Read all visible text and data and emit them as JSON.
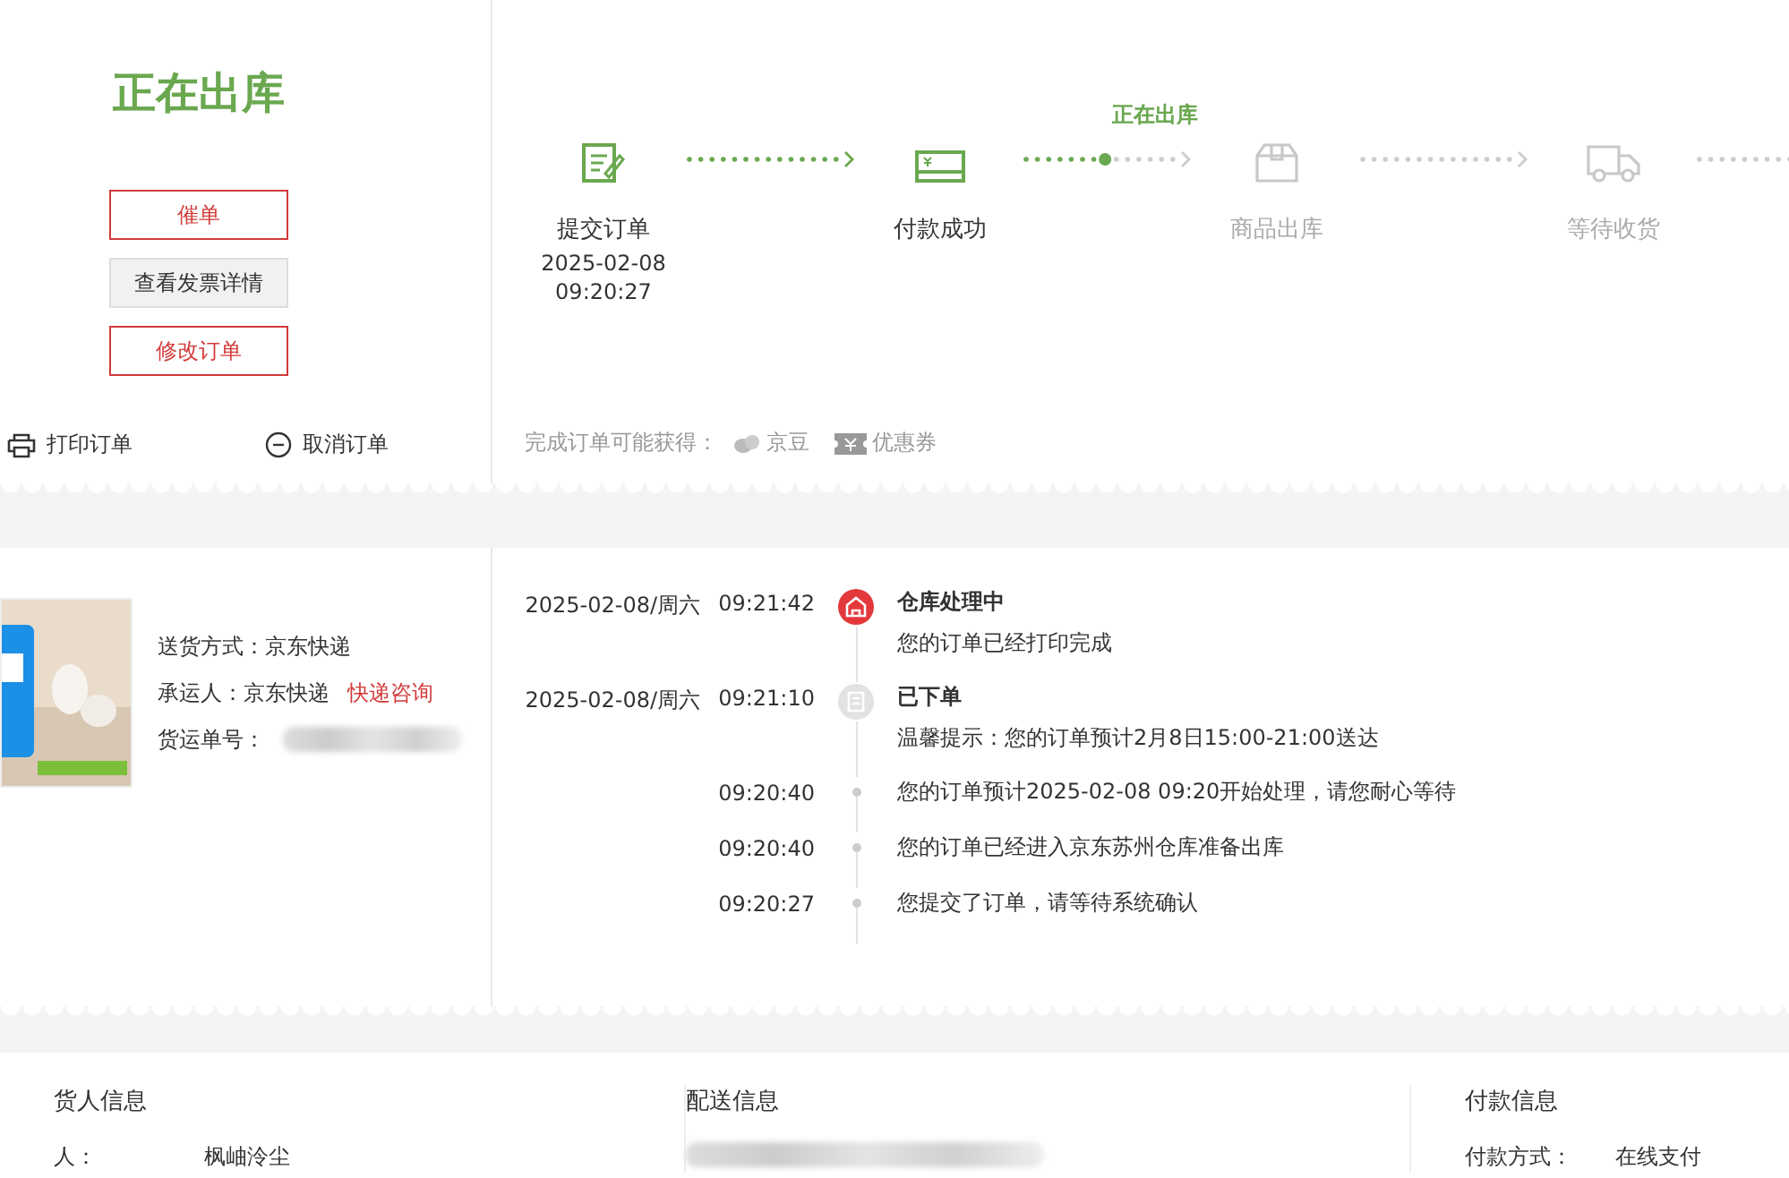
{
  "status": {
    "title": "正在出库"
  },
  "actions": [
    {
      "label": "催单",
      "kind": "primary"
    },
    {
      "label": "查看发票详情",
      "kind": "secondary"
    },
    {
      "label": "修改订单",
      "kind": "primary"
    }
  ],
  "links": [
    {
      "label": "打印订单",
      "kind": "printer"
    },
    {
      "label": "取消订单",
      "kind": "cancel"
    }
  ],
  "steps": [
    {
      "label": "提交订单",
      "date": "2025-02-08",
      "time": "09:20:27",
      "done": true,
      "kind": "form"
    },
    {
      "label": "付款成功",
      "done": true,
      "kind": "card"
    },
    {
      "label": "商品出库",
      "done": false,
      "kind": "box"
    },
    {
      "label": "等待收货",
      "done": false,
      "kind": "truck"
    }
  ],
  "connectors": [
    {
      "kind": "done"
    },
    {
      "kind": "active",
      "label": "正在出库"
    },
    {
      "kind": "pending"
    },
    {
      "kind": "pending"
    }
  ],
  "rewards": {
    "label": "完成订单可能获得：",
    "items": [
      {
        "label": "京豆",
        "kind": "bean"
      },
      {
        "label": "优惠券",
        "kind": "coupon"
      }
    ]
  },
  "shipment": {
    "fields": [
      {
        "label": "送货方式：",
        "value": "京东快递"
      },
      {
        "label": "承运人：",
        "value": "京东快递",
        "link": "快递咨询"
      },
      {
        "label": "货运单号：",
        "redacted": true
      }
    ]
  },
  "tracking": [
    {
      "kind": "current",
      "date": "2025-02-08/周六",
      "time": "09:21:42",
      "title": "仓库处理中",
      "text": "您的订单已经打印完成"
    },
    {
      "kind": "major",
      "date": "2025-02-08/周六",
      "time": "09:21:10",
      "title": "已下单",
      "text": "温馨提示：您的订单预计2月8日15:00-21:00送达"
    },
    {
      "kind": "minor",
      "time": "09:20:40",
      "text": "您的订单预计2025-02-08 09:20开始处理，请您耐心等待"
    },
    {
      "kind": "minor",
      "time": "09:20:40",
      "text": "您的订单已经进入京东苏州仓库准备出库"
    },
    {
      "kind": "minor",
      "time": "09:20:27",
      "text": "您提交了订单，请等待系统确认"
    }
  ],
  "info": [
    {
      "title": "货人信息",
      "rows": [
        {
          "label": "人：",
          "value": "枫岫泠尘"
        }
      ]
    },
    {
      "title": "配送信息",
      "rows": [
        {
          "redacted": true
        }
      ]
    },
    {
      "title": "付款信息",
      "rows": [
        {
          "label": "付款方式：",
          "value": "在线支付"
        }
      ]
    }
  ]
}
